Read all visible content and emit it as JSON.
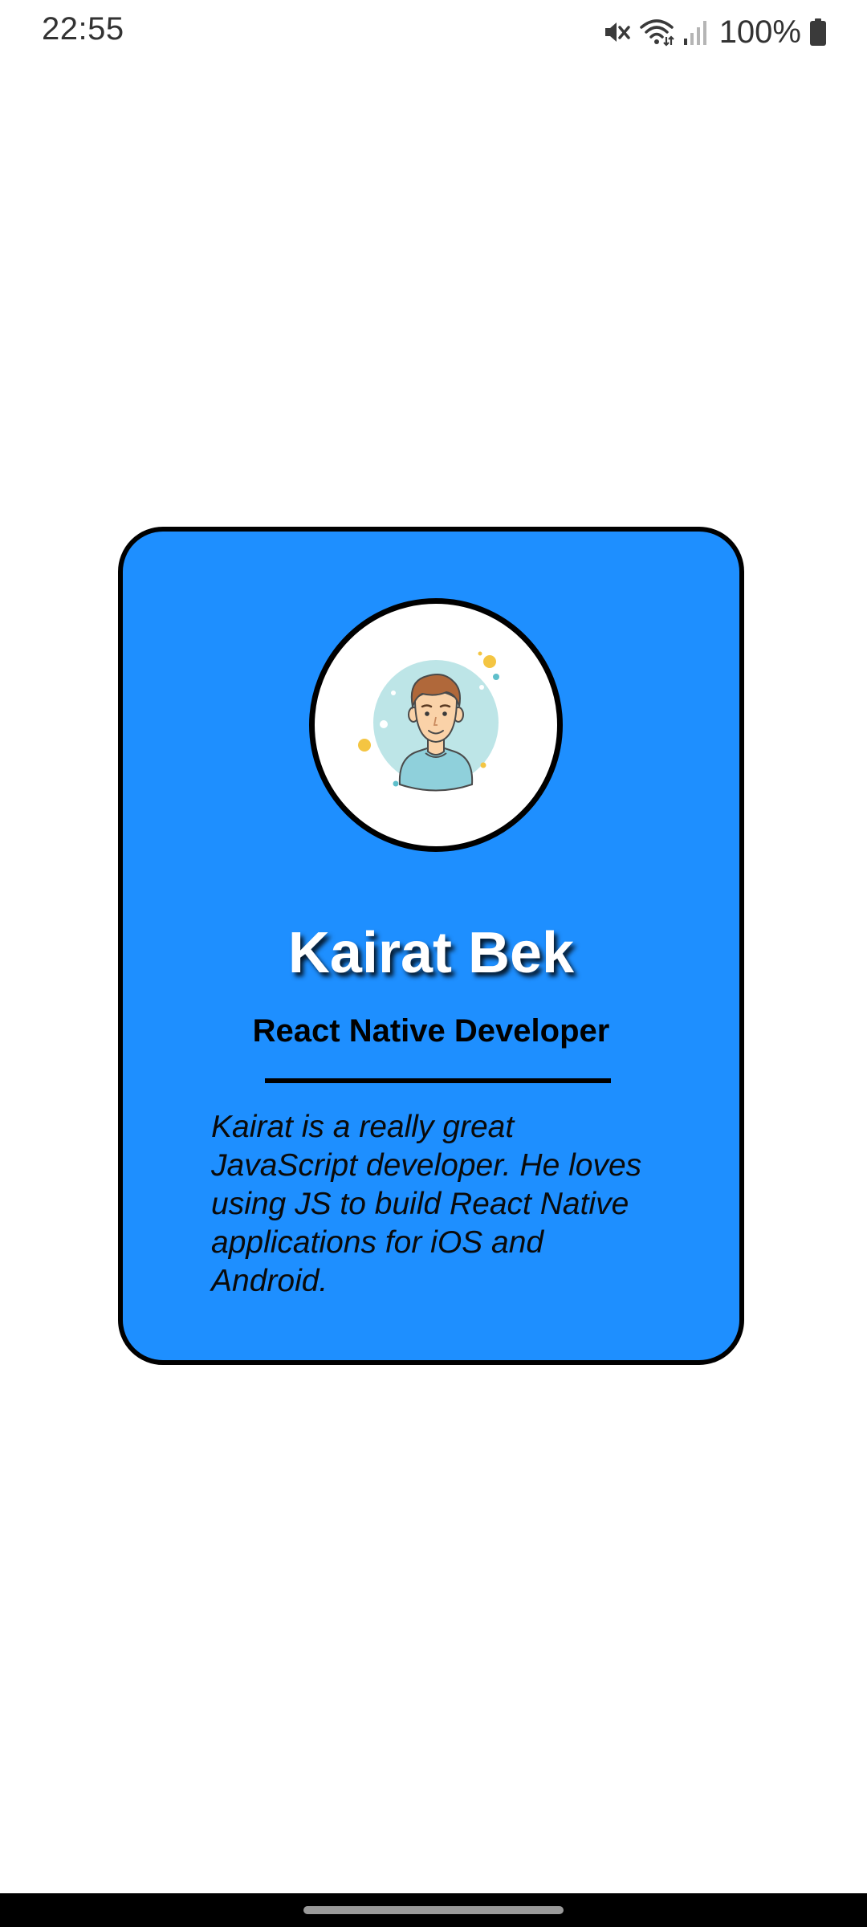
{
  "status_bar": {
    "time": "22:55",
    "battery_percent": "100%",
    "icons": [
      "mute-icon",
      "wifi-icon",
      "signal-icon",
      "battery-icon"
    ]
  },
  "card": {
    "name": "Kairat Bek",
    "role": "React Native Developer",
    "bio": "Kairat is a really great JavaScript developer. He loves using JS to build React Native applications for iOS and Android.",
    "avatar_icon": "user-avatar-illustration",
    "colors": {
      "card_background": "#1E8FFF",
      "border": "#000000",
      "name_text": "#FFFFFF"
    }
  }
}
